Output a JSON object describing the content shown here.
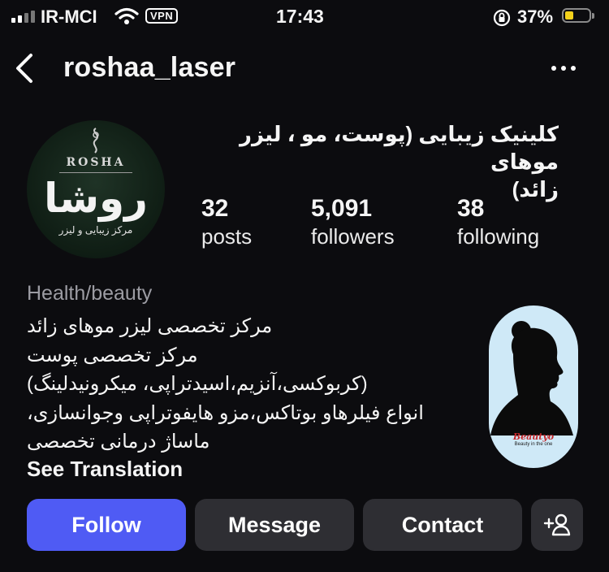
{
  "status_bar": {
    "carrier": "IR-MCI",
    "vpn": "VPN",
    "time": "17:43",
    "battery_percent": "37%",
    "battery_level": 0.37,
    "battery_color": "#f4d21b"
  },
  "header": {
    "username": "roshaa_laser"
  },
  "avatar": {
    "brand": "ROSHA",
    "main_text": "روشا",
    "sub_text": "مرکز زیبایی و لیزر"
  },
  "profile": {
    "name_line1": "کلینیک زیبایی (پوست، مو ، لیزر موهای",
    "name_line2": "زائد)"
  },
  "stats": {
    "posts": {
      "value": "32",
      "label": "posts"
    },
    "followers": {
      "value": "5,091",
      "label": "followers"
    },
    "following": {
      "value": "38",
      "label": "following"
    }
  },
  "bio": {
    "category": "Health/beauty",
    "lines": [
      "مرکز تخصصی لیزر موهای زائد",
      "مرکز تخصصی پوست",
      "(کربوکسی،آنزیم،اسیدتراپی، میکرونیدلینگ)",
      "انواع فیلرهاو بوتاکس،مزو هایفوتراپی وجوانسازی،",
      "ماساژ درمانی تخصصی"
    ],
    "see_translation": "See Translation"
  },
  "highlight": {
    "title": "Beautyo",
    "subtitle": "Beauty in the one"
  },
  "actions": {
    "follow": "Follow",
    "message": "Message",
    "contact": "Contact"
  },
  "colors": {
    "background": "#0c0c0f",
    "follow_button": "#4f5bf4",
    "secondary_button": "#2e2e33",
    "category_text": "#9c9ca3"
  },
  "icons": [
    "back-chevron-icon",
    "more-options-icon",
    "add-person-icon",
    "wifi-icon",
    "rotation-lock-icon",
    "woman-silhouette-icon"
  ]
}
